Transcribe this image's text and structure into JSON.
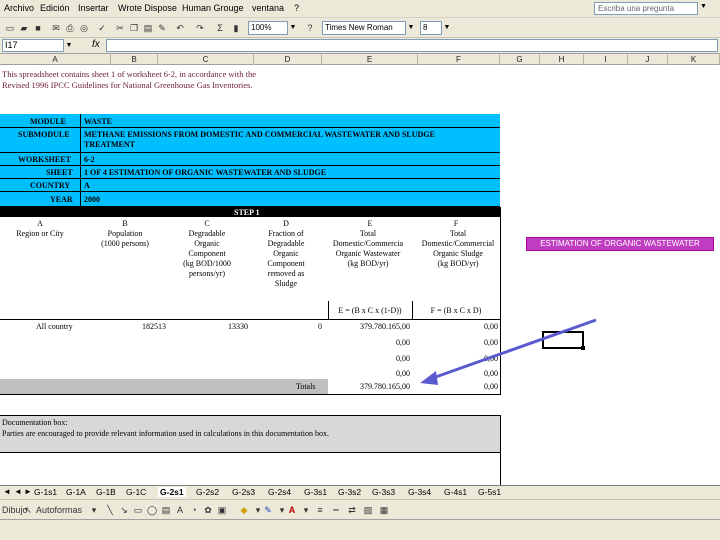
{
  "menubar": {
    "items": [
      "Archivo",
      "Edición",
      "Insertar",
      "Wrote Dispose",
      "Human Grouge",
      "ventana",
      "?"
    ],
    "help_placeholder": "Escriba una pregunta"
  },
  "toolbar": {
    "zoom": "100%",
    "font_name": "Times New Roman",
    "font_size": "8"
  },
  "formula_bar": {
    "name_box": "I17",
    "fx_label": "fx",
    "formula": ""
  },
  "columns": [
    "A",
    "B",
    "C",
    "D",
    "E",
    "F",
    "G",
    "H",
    "I",
    "J",
    "K"
  ],
  "sheet": {
    "intro_line1": "This spreadsheet contains sheet 1 of worksheet 6-2, in accordance with the",
    "intro_line2": "Revised 1996 IPCC Guidelines for National Greenhouse Gas Inventories.",
    "module_label": "MODULE",
    "module_value": "WASTE",
    "submodule_label": "SUBMODULE",
    "submodule_value_line1": "METHANE EMISSIONS FROM DOMESTIC AND COMMERCIAL WASTEWATER AND SLUDGE",
    "submodule_value_line2": "TREATMENT",
    "worksheet_label": "WORKSHEET",
    "worksheet_value": "6-2",
    "sheet_label": "SHEET",
    "sheet_value": "1 OF 4   ESTIMATION OF ORGANIC WASTEWATER AND SLUDGE",
    "country_label": "COUNTRY",
    "country_value": "A",
    "year_label": "YEAR",
    "year_value": "2000",
    "step_label": "STEP 1",
    "col_letters": [
      "A",
      "B",
      "C",
      "D",
      "E",
      "F"
    ],
    "col_a_head": "Region or City",
    "col_b_head": "Population\n(1000 persons)",
    "col_c_head": "Degradable\nOrganic\nComponent\n(kg BOD/1000\npersons/yr)",
    "col_d_head": "Fraction of\nDegradable\nOrganic\nComponent\nremoved as\nSludge",
    "col_e_head": "Total\nDomestic/Commercia\nOrganic Wastewater\n(kg BOD/yr)",
    "col_f_head": "Total\nDomestic/Commercial\nOrganic Sludge\n(kg BOD/yr)",
    "formula_e": "E = (B x C x (1-D))",
    "formula_f": "F = (B x C x D)",
    "row1_region": "All country",
    "row1_b": "182513",
    "row1_c": "13330",
    "row1_d": "0",
    "row1_e": "379.780.165,00",
    "row1_f": "0,00",
    "blank_e": "0,00",
    "blank_f": "0,00",
    "totals_label": "Totals",
    "totals_e": "379.780.165,00",
    "totals_f": "0,00",
    "doc_box_title": "Documentation box:",
    "doc_box_text": "Parties are encouraged to provide relevant information used in calculations in this documentation box.",
    "callout_label": "ESTIMATION OF ORGANIC WASTEWATER"
  },
  "tabs": [
    "G-1s1",
    "G-1A",
    "G-1B",
    "G-1C",
    "G-2s1",
    "G-2s2",
    "G-2s3",
    "G-2s4",
    "G-3s1",
    "G-3s2",
    "G-3s3",
    "G-3s4",
    "G-4s1",
    "G-5s1"
  ],
  "active_tab": "G-2s1",
  "drawbar": {
    "dibujo_label": "Dibujo",
    "autoshapes_label": "Autoformas"
  },
  "colors": {
    "header_cyan": "#00bfff",
    "callout_bg": "#c03cc0",
    "arrow": "#5a5ad0",
    "intro_text": "#6b1a3a"
  }
}
